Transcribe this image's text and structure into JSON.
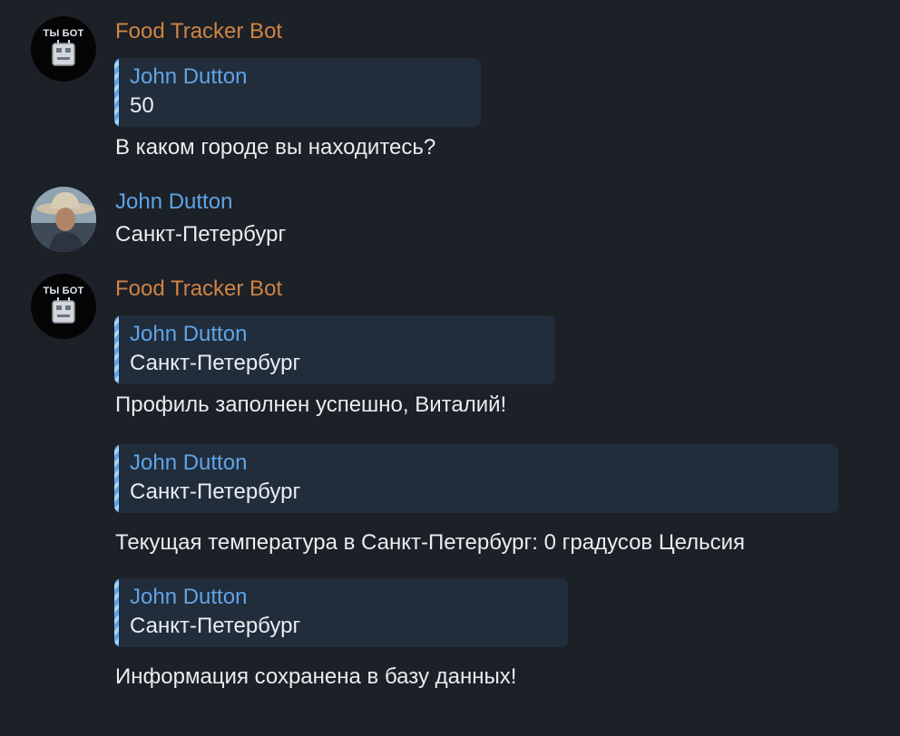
{
  "colors": {
    "background": "#1c2027",
    "bot_name": "#cf8445",
    "user_name": "#5fa4e6",
    "reply_bg": "#222d3c",
    "text": "#e9edf1"
  },
  "bot": {
    "name": "Food Tracker Bot",
    "avatar_text": "ТЫ БОТ",
    "avatar_icon": "robot-icon"
  },
  "user": {
    "name": "John Dutton",
    "avatar_icon": "cowboy-photo"
  },
  "messages": [
    {
      "sender": "Food Tracker Bot",
      "reply": {
        "name": "John Dutton",
        "text": "50"
      },
      "text": "В каком городе вы находитесь?"
    },
    {
      "sender": "John Dutton",
      "text": "Санкт-Петербург"
    },
    {
      "sender": "Food Tracker Bot",
      "reply": {
        "name": "John Dutton",
        "text": "Санкт-Петербург"
      },
      "text": "Профиль заполнен успешно, Виталий!"
    },
    {
      "reply": {
        "name": "John Dutton",
        "text": "Санкт-Петербург"
      },
      "text": "Текущая температура в Санкт-Петербург: 0 градусов Цельсия"
    },
    {
      "reply": {
        "name": "John Dutton",
        "text": "Санкт-Петербург"
      },
      "text": "Информация сохранена в базу данных!"
    }
  ]
}
